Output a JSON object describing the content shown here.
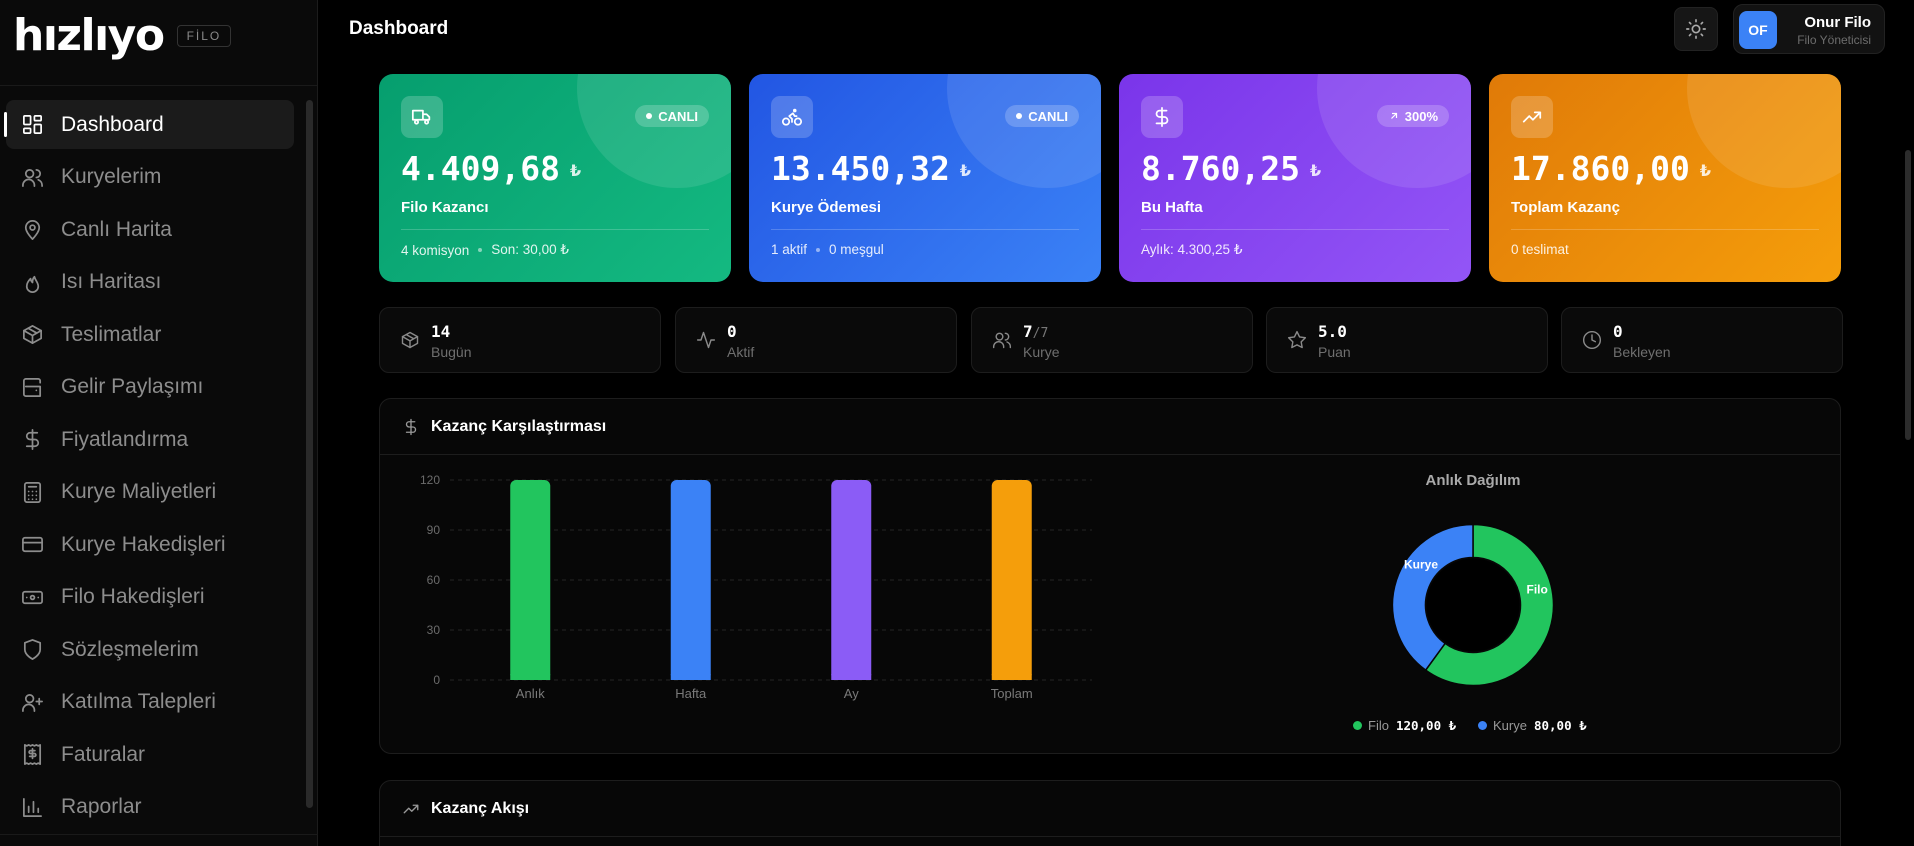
{
  "brand": {
    "logo": "hızlıyo",
    "badge": "FİLO"
  },
  "sidebar": {
    "items": [
      {
        "label": "Dashboard",
        "icon": "dashboard-icon"
      },
      {
        "label": "Kuryelerim",
        "icon": "users-icon"
      },
      {
        "label": "Canlı Harita",
        "icon": "map-pin-icon"
      },
      {
        "label": "Isı Haritası",
        "icon": "flame-icon"
      },
      {
        "label": "Teslimatlar",
        "icon": "package-icon"
      },
      {
        "label": "Gelir Paylaşımı",
        "icon": "wallet-icon"
      },
      {
        "label": "Fiyatlandırma",
        "icon": "dollar-icon"
      },
      {
        "label": "Kurye Maliyetleri",
        "icon": "calculator-icon"
      },
      {
        "label": "Kurye Hakedişleri",
        "icon": "credit-card-icon"
      },
      {
        "label": "Filo Hakedişleri",
        "icon": "banknote-icon"
      },
      {
        "label": "Sözleşmelerim",
        "icon": "shield-icon"
      },
      {
        "label": "Katılma Talepleri",
        "icon": "user-plus-icon"
      },
      {
        "label": "Faturalar",
        "icon": "receipt-icon"
      },
      {
        "label": "Raporlar",
        "icon": "bar-chart-icon"
      }
    ]
  },
  "header": {
    "title": "Dashboard",
    "user": {
      "initials": "OF",
      "name": "Onur Filo",
      "role": "Filo Yöneticisi"
    }
  },
  "cards": [
    {
      "value": "4.409,68",
      "currency": "₺",
      "label": "Filo Kazancı",
      "pill": "CANLI",
      "foot": [
        "4 komisyon",
        "Son: 30,00 ₺"
      ],
      "icon": "truck-icon",
      "color": "#10b981"
    },
    {
      "value": "13.450,32",
      "currency": "₺",
      "label": "Kurye Ödemesi",
      "pill": "CANLI",
      "foot": [
        "1 aktif",
        "0 meşgul"
      ],
      "icon": "bike-icon",
      "color": "#3b82f6"
    },
    {
      "value": "8.760,25",
      "currency": "₺",
      "label": "Bu Hafta",
      "pill": "300%",
      "foot": [
        "Aylık: 4.300,25 ₺"
      ],
      "icon": "dollar-icon",
      "color": "#8b5cf6"
    },
    {
      "value": "17.860,00",
      "currency": "₺",
      "label": "Toplam Kazanç",
      "pill": "",
      "foot": [
        "0 teslimat"
      ],
      "icon": "trending-up-icon",
      "color": "#f59e0b"
    }
  ],
  "mini_stats": [
    {
      "value": "14",
      "sub": "",
      "label": "Bugün",
      "icon": "package-icon"
    },
    {
      "value": "0",
      "sub": "",
      "label": "Aktif",
      "icon": "activity-icon"
    },
    {
      "value": "7",
      "sub": "/7",
      "label": "Kurye",
      "icon": "users-icon"
    },
    {
      "value": "5.0",
      "sub": "",
      "label": "Puan",
      "icon": "star-icon"
    },
    {
      "value": "0",
      "sub": "",
      "label": "Bekleyen",
      "icon": "clock-icon"
    }
  ],
  "earnings_panel": {
    "title": "Kazanç Karşılaştırması",
    "icon": "dollar-icon"
  },
  "flow_panel": {
    "title": "Kazanç Akışı",
    "icon": "trending-up-icon"
  },
  "chart_data": [
    {
      "type": "bar",
      "title": "",
      "categories": [
        "Anlık",
        "Hafta",
        "Ay",
        "Toplam"
      ],
      "values": [
        120,
        120,
        120,
        120
      ],
      "colors": [
        "#22c55e",
        "#3b82f6",
        "#8b5cf6",
        "#f59e0b"
      ],
      "yticks": [
        0,
        30,
        60,
        90,
        120
      ],
      "ylim": [
        0,
        120
      ],
      "grid": true
    },
    {
      "type": "pie",
      "title": "Anlık Dağılım",
      "labels": [
        "Filo",
        "Kurye"
      ],
      "values": [
        120,
        80
      ],
      "value_labels": [
        "120,00 ₺",
        "80,00 ₺"
      ],
      "colors": [
        "#22c55e",
        "#3b82f6"
      ],
      "donut": true
    }
  ]
}
